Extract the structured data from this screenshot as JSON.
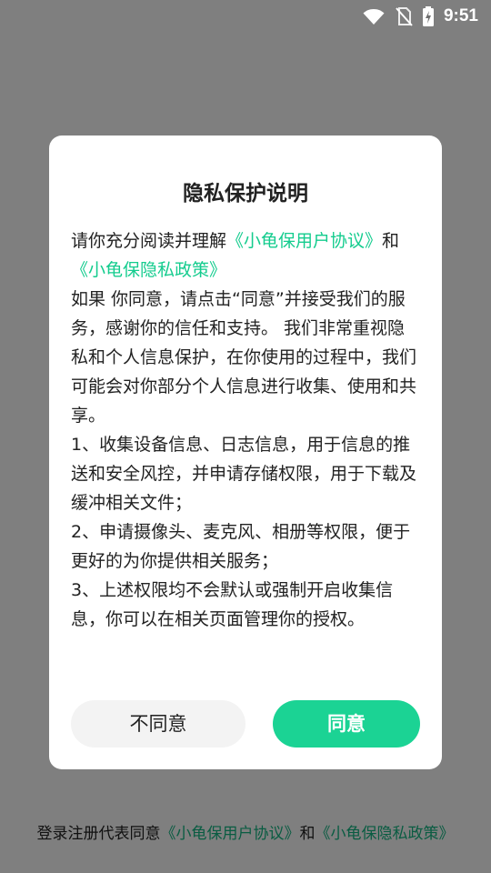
{
  "status_bar": {
    "time": "9:51",
    "icons": [
      "wifi-icon",
      "no-sim-icon",
      "battery-charging-icon"
    ]
  },
  "colors": {
    "accent": "#1bd394",
    "link": "#14cc8e",
    "overlay": "rgba(0,0,0,0.5)"
  },
  "dialog": {
    "title": "隐私保护说明",
    "intro_prefix": "请你充分阅读并理解",
    "user_agreement_link": "《小龟保用户协议》",
    "intro_and": "和",
    "privacy_policy_link": "《小龟保隐私政策》",
    "paragraph_main": "如果 你同意，请点击“同意”并接受我们的服务，感谢你的信任和支持。 我们非常重视隐私和个人信息保护，在你使用的过程中，我们可能会对你部分个人信息进行收集、使用和共享。",
    "item_1": "1、收集设备信息、日志信息，用于信息的推送和安全风控，并申请存储权限，用于下载及缓冲相关文件；",
    "item_2": "2、申请摄像头、麦克风、相册等权限，便于更好的为你提供相关服务；",
    "item_3": "3、上述权限均不会默认或强制开启收集信息，你可以在相关页面管理你的授权。",
    "disagree_label": "不同意",
    "agree_label": "同意"
  },
  "footer": {
    "prefix": "登录注册代表同意",
    "user_agreement_link": "《小龟保用户协议》",
    "and": "和",
    "privacy_policy_link": "《小龟保隐私政策》"
  }
}
